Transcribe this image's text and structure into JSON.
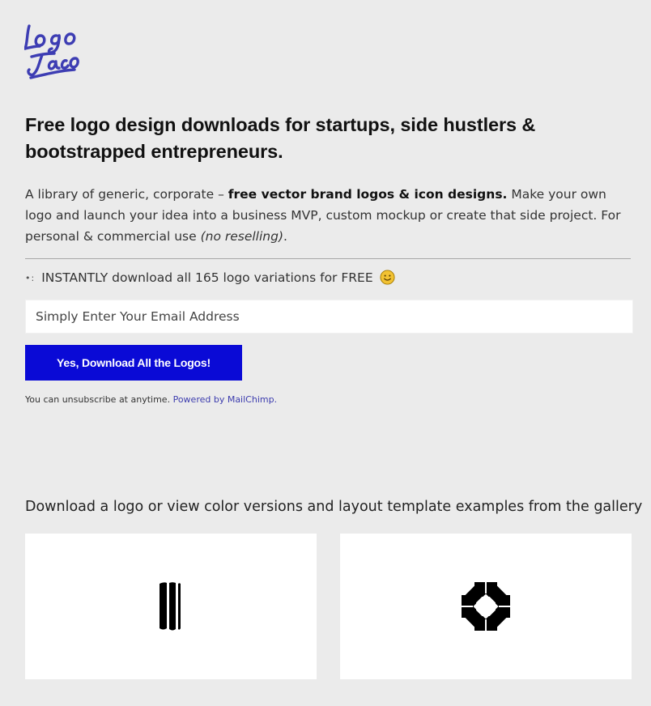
{
  "brand": {
    "logo_text": "Logo Taco",
    "logo_color": "#3d3db3"
  },
  "hero": {
    "headline": "Free logo design downloads for startups, side hustlers & bootstrapped entrepreneurs.",
    "intro_prefix": "A library of generic, corporate – ",
    "intro_bold": "free vector brand logos & icon designs.",
    "intro_middle": " Make your own logo and launch your idea into a business MVP, custom mockup or create that side project. For personal & commercial use ",
    "intro_italic": "(no reselling)",
    "intro_suffix": "."
  },
  "signup": {
    "bullet": "•:",
    "instant_text": "INSTANTLY download all 165 logo variations for FREE",
    "email_placeholder": "Simply Enter Your Email Address",
    "email_value": "",
    "button_label": "Yes, Download All the Logos!",
    "unsubscribe_text": "You can unsubscribe at anytime.",
    "powered_link": "Powered by MailChimp.",
    "button_color": "#0a0ad6",
    "link_color": "#3c3cae"
  },
  "gallery": {
    "intro": "Download a logo or view color versions and layout template examples from the gallery",
    "items": [
      {
        "icon": "bars-logo-icon"
      },
      {
        "icon": "flower-logo-icon"
      }
    ]
  },
  "colors": {
    "page_background": "#ebebeb",
    "card_background": "#ffffff",
    "smiley_color": "#f2c233"
  }
}
